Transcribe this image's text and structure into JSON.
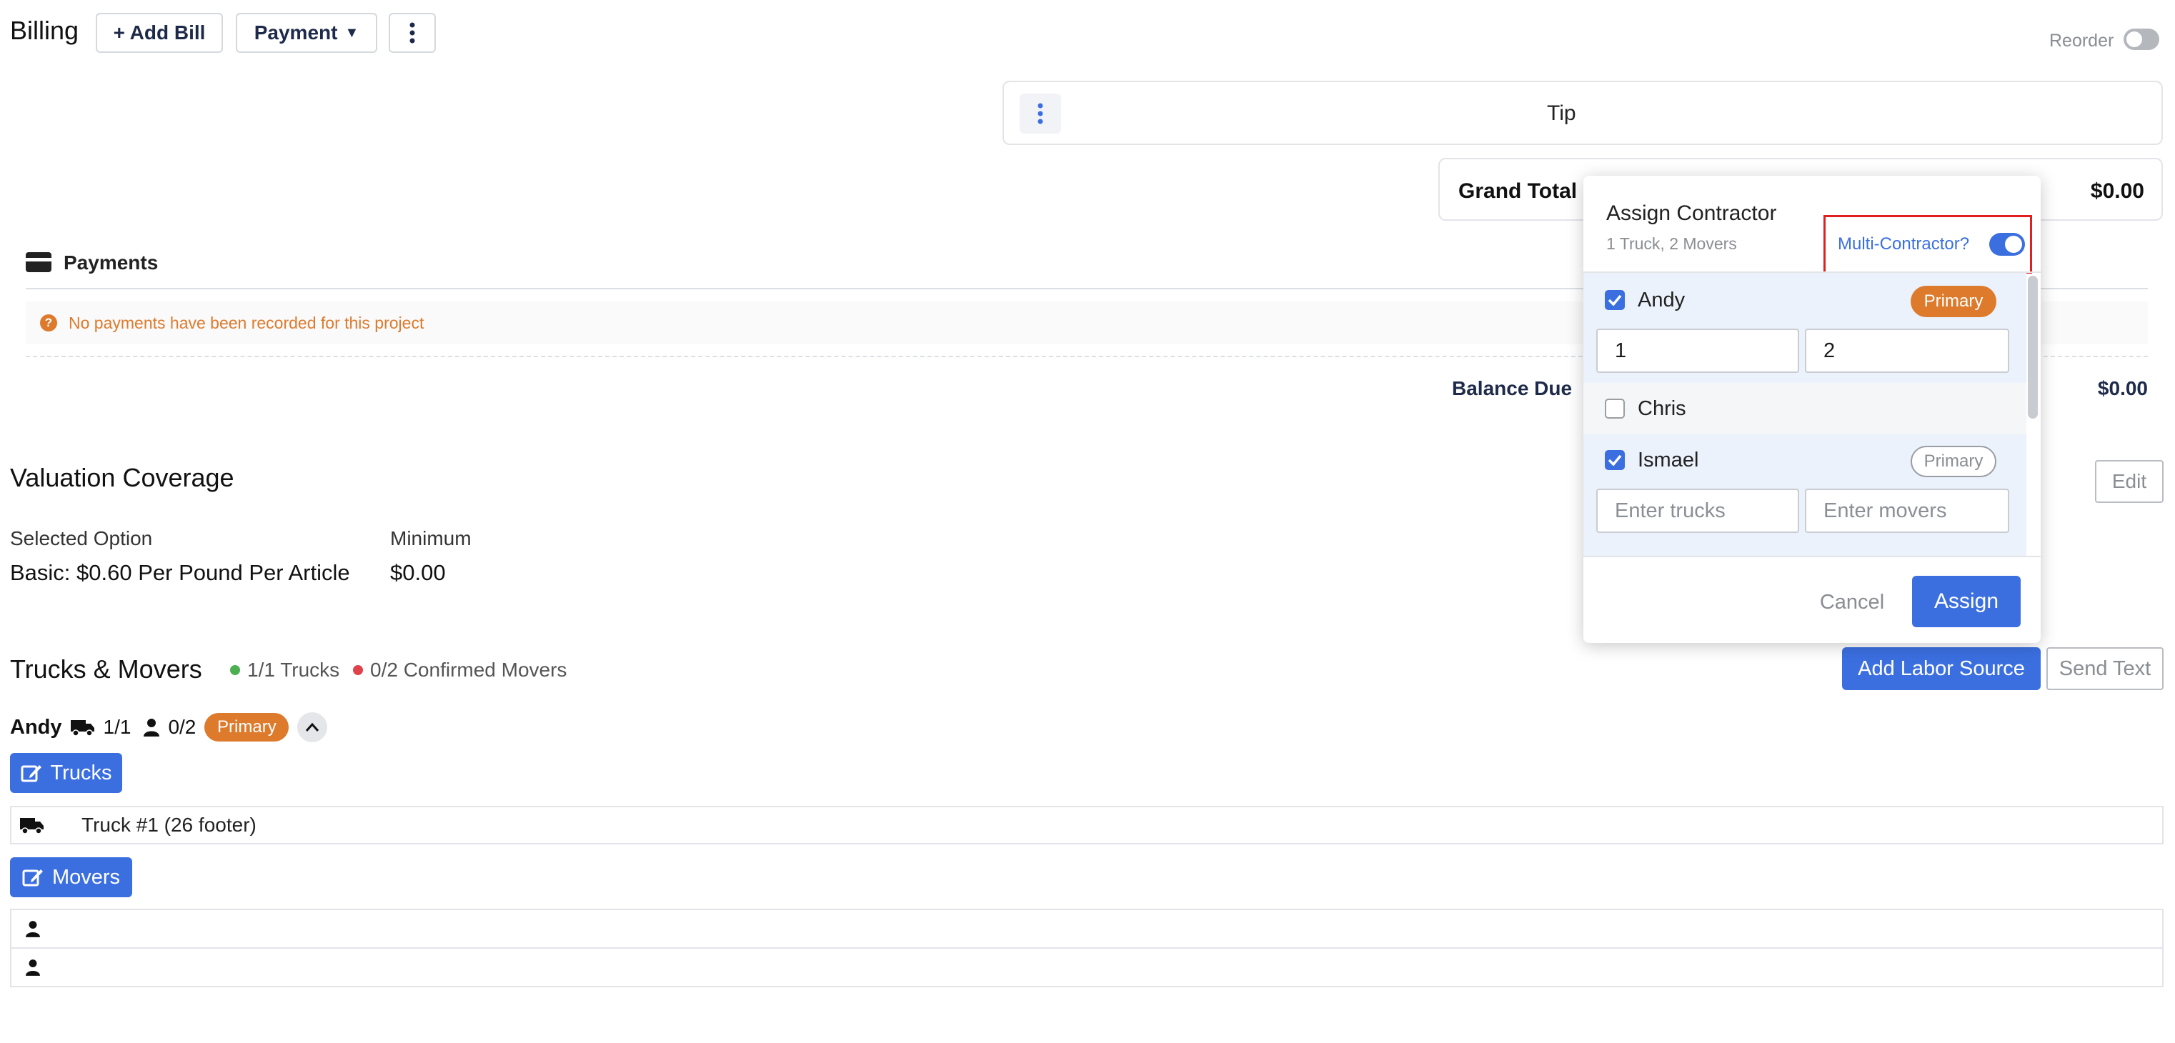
{
  "header": {
    "title": "Billing",
    "add_bill_label": "+ Add Bill",
    "payment_label": "Payment",
    "reorder_label": "Reorder"
  },
  "tip": {
    "label": "Tip"
  },
  "grand_total": {
    "label": "Grand Total",
    "value": "$0.00"
  },
  "payments": {
    "title": "Payments",
    "notice": "No payments have been recorded for this project",
    "balance_label": "Balance Due",
    "balance_value": "$0.00"
  },
  "valuation": {
    "title": "Valuation Coverage",
    "edit_label": "Edit",
    "selected_option_label": "Selected Option",
    "selected_option_value": "Basic: $0.60 Per Pound Per Article",
    "minimum_label": "Minimum",
    "minimum_value": "$0.00"
  },
  "trucks_movers": {
    "title": "Trucks & Movers",
    "trucks_status": "1/1 Trucks",
    "movers_status": "0/2 Confirmed Movers",
    "add_labor_label": "Add Labor Source",
    "send_text_label": "Send Text",
    "contractor": {
      "name": "Andy",
      "trucks_count": "1/1",
      "movers_count": "0/2",
      "badge": "Primary"
    },
    "trucks_button": "Trucks",
    "truck_item": "Truck #1 (26 footer)",
    "movers_button": "Movers"
  },
  "modal": {
    "title": "Assign Contractor",
    "subtitle": "1 Truck, 2 Movers",
    "multi_label": "Multi-Contractor?",
    "contractors": [
      {
        "name": "Andy",
        "checked": true,
        "badge": "Primary",
        "trucks_value": "1",
        "movers_value": "2"
      },
      {
        "name": "Chris",
        "checked": false
      },
      {
        "name": "Ismael",
        "checked": true,
        "badge": "Primary",
        "trucks_placeholder": "Enter trucks",
        "movers_placeholder": "Enter movers"
      }
    ],
    "cancel_label": "Cancel",
    "assign_label": "Assign"
  },
  "colors": {
    "accent_blue": "#3b6fe0",
    "primary_orange": "#dd7a2c",
    "status_green": "#4caf50",
    "status_red": "#e0424b",
    "highlight_red": "#e02020",
    "navy_text": "#1e2a4a"
  }
}
